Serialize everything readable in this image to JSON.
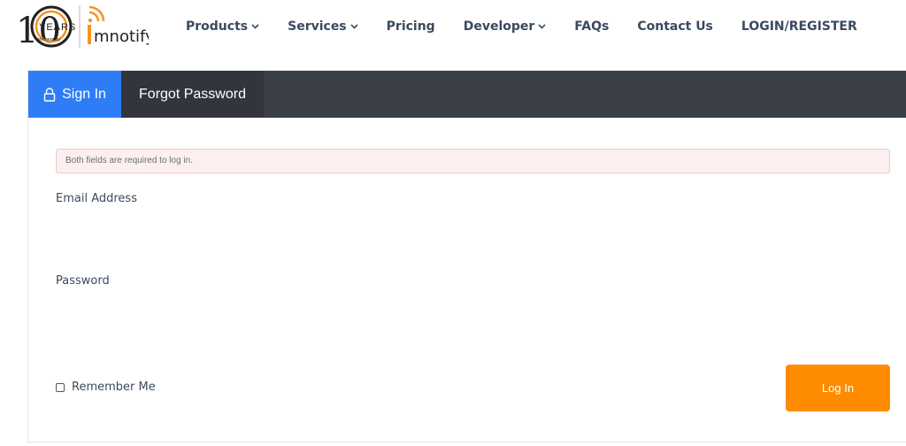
{
  "brand": {
    "anniversary_number": "10",
    "anniversary_word": "YEARS",
    "anniversary_sub": "anniversary",
    "name": "mnotify",
    "accent_color": "#f7941d"
  },
  "nav": {
    "items": [
      {
        "label": "Products",
        "has_dropdown": true
      },
      {
        "label": "Services",
        "has_dropdown": true
      },
      {
        "label": "Pricing",
        "has_dropdown": false
      },
      {
        "label": "Developer",
        "has_dropdown": true
      },
      {
        "label": "FAQs",
        "has_dropdown": false
      },
      {
        "label": "Contact Us",
        "has_dropdown": false
      },
      {
        "label": "LOGIN/REGISTER",
        "has_dropdown": false
      }
    ]
  },
  "tabs": {
    "signin": {
      "label": "Sign In",
      "icon": "lock-icon",
      "active": true,
      "color": "#2f7df6"
    },
    "forgot": {
      "label": "Forgot Password",
      "active": false
    }
  },
  "form": {
    "alert": "Both fields are required to log in.",
    "email_label": "Email Address",
    "email_value": "",
    "password_label": "Password",
    "password_value": "",
    "remember_label": "Remember Me",
    "remember_checked": false,
    "submit_label": "Log In",
    "submit_color": "#ff8c00"
  }
}
